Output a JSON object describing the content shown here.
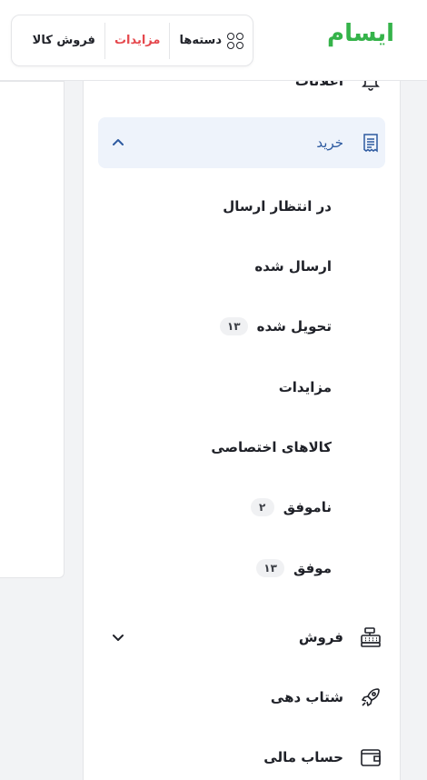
{
  "header": {
    "logo": "ایسام",
    "nav": [
      {
        "label": "دسته‌ها",
        "icon": "categories-icon"
      },
      {
        "label": "مزایدات",
        "active": true
      },
      {
        "label": "فروش کالا"
      }
    ]
  },
  "sidebar": {
    "notifications": {
      "label": "اعلانات",
      "icon": "bell-icon"
    },
    "buy": {
      "label": "خرید",
      "icon": "receipt-icon",
      "sub": [
        {
          "label": "در انتظار ارسال"
        },
        {
          "label": "ارسال شده"
        },
        {
          "label": "تحویل شده",
          "badge": "۱۳"
        },
        {
          "label": "مزایدات"
        },
        {
          "label": "کالاهای اختصاصی"
        },
        {
          "label": "ناموفق",
          "badge": "۲"
        },
        {
          "label": "موفق",
          "badge": "۱۳"
        }
      ]
    },
    "sell": {
      "label": "فروش",
      "icon": "cash-register-icon"
    },
    "boost": {
      "label": "شتاب دهی",
      "icon": "rocket-icon"
    },
    "wallet": {
      "label": "حساب مالی",
      "icon": "wallet-icon"
    }
  },
  "colors": {
    "accent": "#2d5aa0",
    "brand": "#35b34a",
    "active_nav": "#e5484d"
  }
}
